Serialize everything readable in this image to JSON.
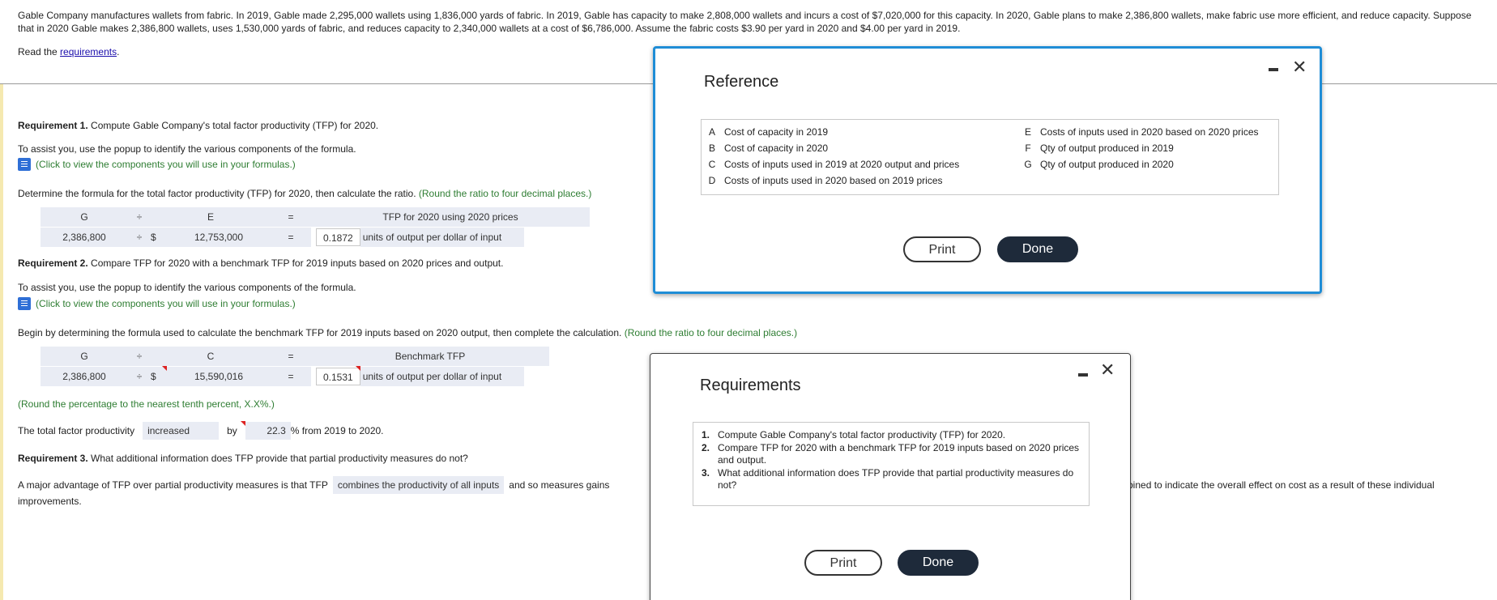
{
  "intro": "Gable Company manufactures wallets from fabric. In 2019, Gable made 2,295,000 wallets using 1,836,000 yards of fabric. In 2019, Gable has capacity to make 2,808,000 wallets and incurs a cost of $7,020,000 for this capacity. In 2020, Gable plans to make 2,386,800 wallets, make fabric use more efficient, and reduce capacity. Suppose that in 2020 Gable makes 2,386,800 wallets, uses 1,530,000 yards of fabric, and reduces capacity to 2,340,000 wallets at a cost of $6,786,000. Assume the fabric costs $3.90 per yard in 2020 and $4.00 per yard in 2019.",
  "read_prefix": "Read the ",
  "read_link": "requirements",
  "read_suffix": ".",
  "req1": {
    "label": "Requirement 1.",
    "text": " Compute Gable Company's total factor productivity (TFP) for 2020.",
    "assist": "To assist you, use the popup to identify the various components of the formula.",
    "link": "(Click to view the components you will use in your formulas.)",
    "determine": "Determine the formula for the total factor productivity (TFP) for 2020, then calculate the ratio.",
    "round": " (Round the ratio to four decimal places.)",
    "h_num": "G",
    "h_div": "÷",
    "h_den": "E",
    "h_eq": "=",
    "h_result": "TFP for 2020 using 2020 prices",
    "num": "2,386,800",
    "div": "÷",
    "dollar": "$",
    "den": "12,753,000",
    "eq": "=",
    "result": "0.1872",
    "unit": "units of output per dollar of input"
  },
  "req2": {
    "label": "Requirement 2.",
    "text": " Compare TFP for 2020 with a benchmark TFP for 2019 inputs based on 2020 prices and output.",
    "assist": "To assist you, use the popup to identify the various components of the formula.",
    "link": "(Click to view the components you will use in your formulas.)",
    "begin": "Begin by determining the formula used to calculate the benchmark TFP for 2019 inputs based on 2020 output, then complete the calculation.",
    "round": " (Round the ratio to four decimal places.)",
    "h_num": "G",
    "h_div": "÷",
    "h_den": "C",
    "h_eq": "=",
    "h_result": "Benchmark TFP",
    "num": "2,386,800",
    "div": "÷",
    "dollar": "$",
    "den": "15,590,016",
    "eq": "=",
    "result": "0.1531",
    "unit": "units of output per dollar of input",
    "round_pct": "(Round the percentage to the nearest tenth percent, X.X%.)",
    "tfp_prefix": "The total factor productivity",
    "tfp_dir": "increased",
    "tfp_by": "by",
    "tfp_pct": "22.3",
    "tfp_suffix": "% from 2019 to 2020."
  },
  "req3": {
    "label": "Requirement 3.",
    "text": " What additional information does TFP provide that partial productivity measures do not?",
    "line_prefix": "A major advantage of TFP over partial productivity measures is that TFP",
    "choice": "combines the productivity of all inputs",
    "line_mid": "and so measures gains",
    "line_right": "bined to indicate the overall effect on cost as a result of these individual",
    "line_end": "improvements."
  },
  "reference_modal": {
    "title": "Reference",
    "left": [
      {
        "k": "A",
        "v": "Cost of capacity in 2019"
      },
      {
        "k": "B",
        "v": "Cost of capacity in 2020"
      },
      {
        "k": "C",
        "v": "Costs of inputs used in 2019 at 2020 output and prices"
      },
      {
        "k": "D",
        "v": "Costs of inputs used in 2020 based on 2019 prices"
      }
    ],
    "right": [
      {
        "k": "E",
        "v": "Costs of inputs used in 2020 based on 2020 prices"
      },
      {
        "k": "F",
        "v": "Qty of output produced in 2019"
      },
      {
        "k": "G",
        "v": "Qty of output produced in 2020"
      }
    ],
    "print": "Print",
    "done": "Done",
    "close": "✕"
  },
  "requirements_modal": {
    "title": "Requirements",
    "items": [
      {
        "n": "1.",
        "t": "Compute Gable Company's total factor productivity (TFP) for 2020."
      },
      {
        "n": "2.",
        "t": "Compare TFP for 2020 with a benchmark TFP for 2019 inputs based on 2020 prices and output."
      },
      {
        "n": "3.",
        "t": "What additional information does TFP provide that partial productivity measures do not?"
      }
    ],
    "print": "Print",
    "done": "Done",
    "close": "✕"
  },
  "colors": {
    "accent": "#1f8dd6",
    "green": "#2e7d32",
    "dark_button": "#1e2a3a",
    "flag": "#d22222"
  }
}
